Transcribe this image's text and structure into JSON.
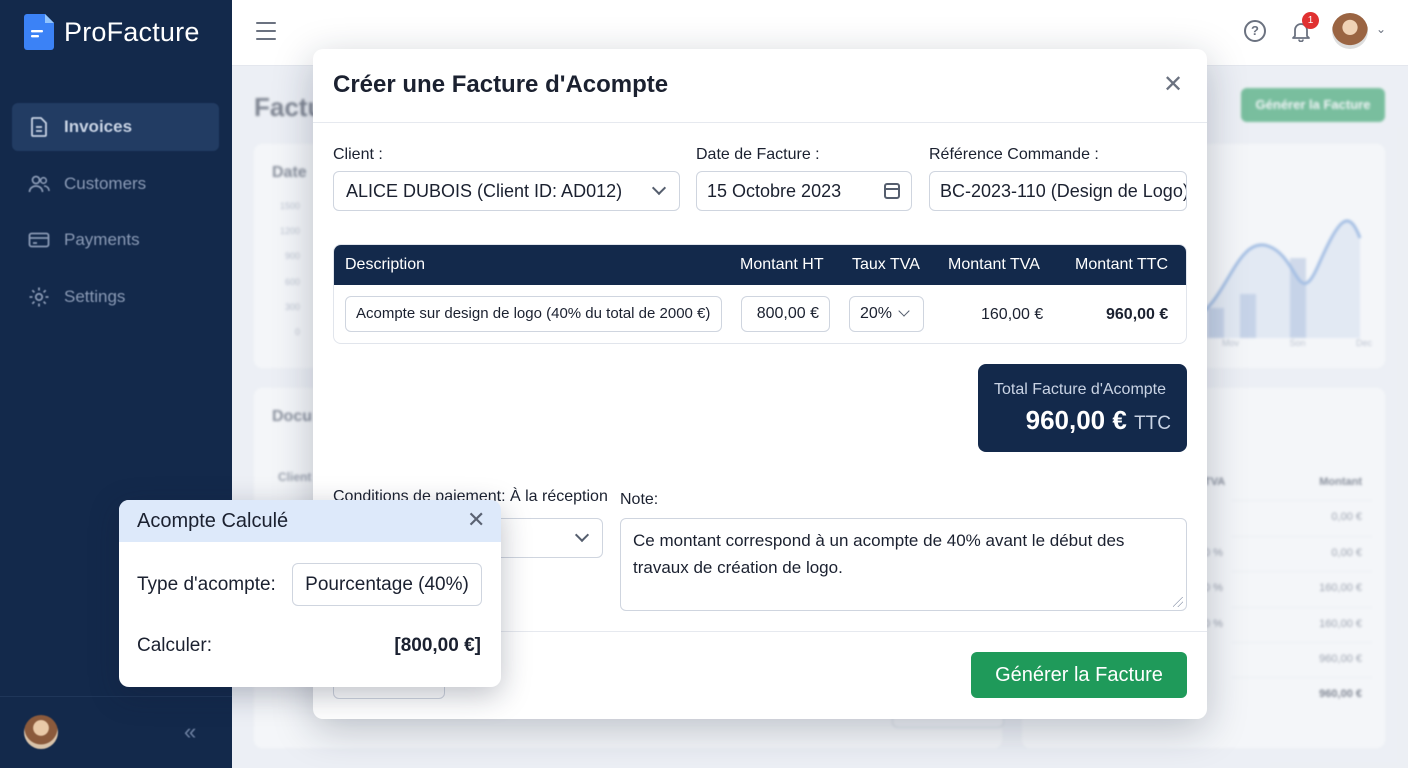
{
  "app": {
    "name": "ProFacture"
  },
  "sidebar": {
    "items": [
      {
        "label": "Invoices",
        "icon": "file-icon",
        "active": true
      },
      {
        "label": "Customers",
        "icon": "users-icon",
        "active": false
      },
      {
        "label": "Payments",
        "icon": "credit-card-icon",
        "active": false
      },
      {
        "label": "Settings",
        "icon": "gear-icon",
        "active": false
      }
    ]
  },
  "topbar": {
    "notification_count": "1"
  },
  "background": {
    "page_title": "Factu",
    "generate_label": "Générer la Facture",
    "chart_label": "Date",
    "chart_axis": [
      "1500",
      "1200",
      "900",
      "600",
      "300",
      "0"
    ],
    "chart_months": [
      "Mov",
      "Son",
      "Dec"
    ],
    "docs_label": "Docu",
    "client_label": "Client",
    "table_head": [
      "TVA",
      "Montant"
    ],
    "table_rows": [
      {
        "tva": "",
        "montant": "0,00 €"
      },
      {
        "tva": "0 %",
        "montant": "0,00 €"
      },
      {
        "tva": "0 %",
        "montant": "160,00 €"
      },
      {
        "tva": "0 %",
        "montant": "160,00 €"
      },
      {
        "tva": "",
        "montant": "960,00 €"
      },
      {
        "tva": "",
        "montant": "960,00 €"
      }
    ]
  },
  "modal": {
    "title": "Créer une Facture d'Acompte",
    "client": {
      "label": "Client :",
      "value": "ALICE DUBOIS (Client ID: AD012)"
    },
    "date": {
      "label": "Date de Facture :",
      "value": "15 Octobre 2023"
    },
    "reference": {
      "label": "Référence Commande :",
      "value": "BC-2023-110 (Design de Logo)"
    },
    "table": {
      "headers": [
        "Description",
        "Montant HT",
        "Taux TVA",
        "Montant TVA",
        "Montant TTC"
      ],
      "row": {
        "description": "Acompte sur design de logo (40% du total de 2000 €)",
        "montant_ht": "800,00 €",
        "taux_tva": "20%",
        "montant_tva": "160,00 €",
        "montant_ttc": "960,00 €"
      }
    },
    "total": {
      "label": "Total Facture d'Acompte",
      "value": "960,00 €",
      "suffix": "TTC"
    },
    "payment_terms": {
      "label": "Conditions de paiement: À la réception"
    },
    "note": {
      "label": "Note:",
      "value": "Ce montant correspond à un acompte de 40% avant le début des travaux de création de logo."
    },
    "generate_label": "Générer la Facture"
  },
  "popup": {
    "title": "Acompte Calculé",
    "type_label": "Type d'acompte:",
    "type_value": "Pourcentage (40%)",
    "calc_label": "Calculer:",
    "calc_value": "[800,00 €]"
  },
  "colors": {
    "navy": "#13294b",
    "green": "#1f9a5a",
    "popup_header": "#dde9fa",
    "badge": "#e03131"
  }
}
